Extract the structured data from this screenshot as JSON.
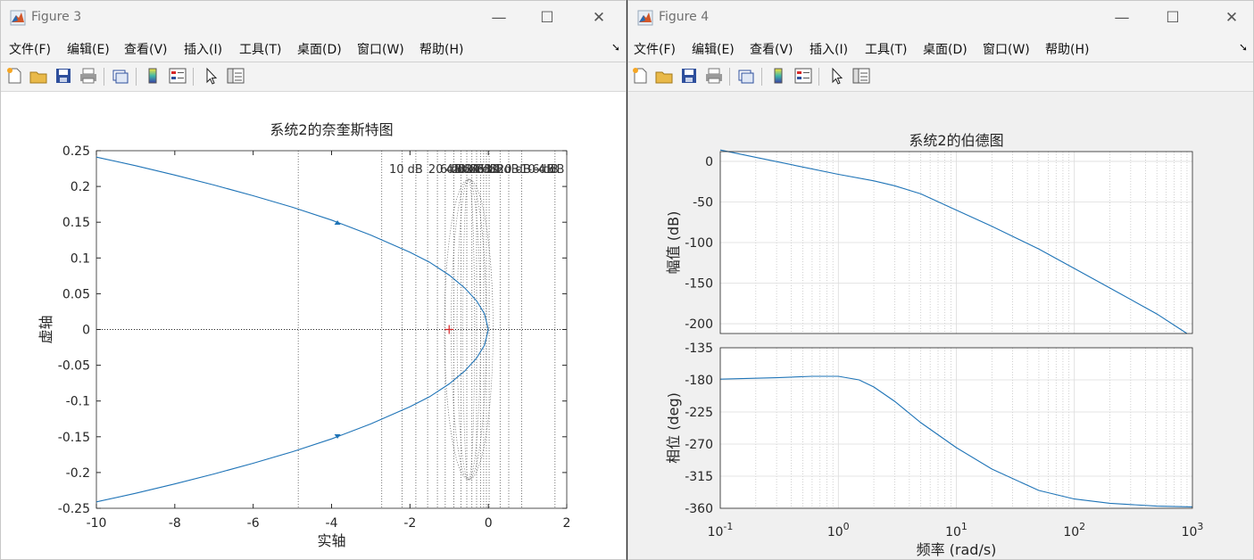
{
  "windows": {
    "fig3": {
      "title": "Figure 3",
      "menus": [
        "文件(F)",
        "编辑(E)",
        "查看(V)",
        "插入(I)",
        "工具(T)",
        "桌面(D)",
        "窗口(W)",
        "帮助(H)"
      ],
      "window_buttons": {
        "minimize": "—",
        "maximize": "☐",
        "close": "✕"
      }
    },
    "fig4": {
      "title": "Figure 4",
      "menus": [
        "文件(F)",
        "编辑(E)",
        "查看(V)",
        "插入(I)",
        "工具(T)",
        "桌面(D)",
        "窗口(W)",
        "帮助(H)"
      ],
      "window_buttons": {
        "minimize": "—",
        "maximize": "☐",
        "close": "✕"
      }
    }
  },
  "colors": {
    "line": "#1f74b7",
    "critical_point": "#d62728",
    "axis": "#262626",
    "grid": "#cfcfcf"
  },
  "icons": [
    "new-figure-icon",
    "open-file-icon",
    "save-icon",
    "print-icon",
    "link-plot-icon",
    "colorbar-icon",
    "legend-icon",
    "edit-pointer-icon",
    "property-inspector-icon"
  ],
  "chart_data": [
    {
      "type": "line",
      "kind": "nyquist",
      "title": "系统2的奈奎斯特图",
      "xlabel": "实轴",
      "ylabel": "虚轴",
      "xlim": [
        -10,
        2
      ],
      "ylim": [
        -0.25,
        0.25
      ],
      "xticks": [
        "-10",
        "-8",
        "-6",
        "-4",
        "-2",
        "0",
        "2"
      ],
      "yticks": [
        "0.25",
        "0.2",
        "0.15",
        "0.1",
        "0.05",
        "0",
        "-0.05",
        "-0.1",
        "-0.15",
        "-0.2",
        "-0.25"
      ],
      "critical_point": {
        "x": -1,
        "y": 0
      },
      "grid": "M-circles (dotted)",
      "grid_labels": [
        "10 dB",
        "20 dB",
        "6 dB",
        "4 dB",
        "2 dB",
        "0 dB",
        "-2 dB",
        "-4 dB",
        "-6 dB",
        "-10 dB",
        "-20 dB",
        "-10 dB",
        "-6 dB",
        "-4 dB"
      ],
      "series": [
        {
          "x": [
            -10,
            -9,
            -8,
            -7,
            -6,
            -5,
            -4,
            -3,
            -2,
            -1.5,
            -1,
            -0.6,
            -0.3,
            -0.1,
            0
          ],
          "y": [
            0.241,
            0.229,
            0.216,
            0.202,
            0.187,
            0.171,
            0.153,
            0.132,
            0.108,
            0.094,
            0.076,
            0.058,
            0.04,
            0.022,
            0
          ]
        },
        {
          "x": [
            0,
            -0.1,
            -0.3,
            -0.6,
            -1,
            -1.5,
            -2,
            -3,
            -4,
            -5,
            -6,
            -7,
            -8,
            -9,
            -10
          ],
          "y": [
            0,
            -0.022,
            -0.04,
            -0.058,
            -0.076,
            -0.094,
            -0.108,
            -0.132,
            -0.153,
            -0.171,
            -0.187,
            -0.202,
            -0.216,
            -0.229,
            -0.241
          ]
        }
      ],
      "arrows": [
        {
          "x": -3.85,
          "y": 0.149
        },
        {
          "x": -3.85,
          "y": -0.149
        }
      ]
    },
    {
      "type": "line",
      "kind": "bode",
      "title": "系统2的伯德图",
      "xlabel": "频率  (rad/s)",
      "xscale": "log",
      "xlim": [
        0.1,
        1000
      ],
      "xticks": [
        "10^-1",
        "10^0",
        "10^1",
        "10^2",
        "10^3"
      ],
      "magnitude": {
        "ylabel": "幅值 (dB)",
        "ylim": [
          -212,
          12
        ],
        "yticks": [
          "0",
          "-50",
          "-100",
          "-150",
          "-200"
        ],
        "x": [
          0.1,
          0.2,
          0.5,
          1,
          2,
          3,
          5,
          10,
          20,
          50,
          100,
          200,
          500,
          900
        ],
        "y": [
          14,
          5,
          -7,
          -16,
          -24,
          -30,
          -40,
          -60,
          -80,
          -108,
          -132,
          -156,
          -188,
          -212
        ]
      },
      "phase": {
        "ylabel": "相位 (deg)",
        "ylim": [
          -360,
          -135
        ],
        "yticks": [
          "-135",
          "-180",
          "-225",
          "-270",
          "-315",
          "-360"
        ],
        "x": [
          0.1,
          0.3,
          0.6,
          1,
          1.5,
          2,
          3,
          5,
          10,
          20,
          50,
          100,
          200,
          500,
          1000
        ],
        "y": [
          -179,
          -177,
          -175,
          -175,
          -180,
          -190,
          -210,
          -240,
          -275,
          -305,
          -335,
          -347,
          -353,
          -357,
          -358
        ]
      }
    }
  ]
}
